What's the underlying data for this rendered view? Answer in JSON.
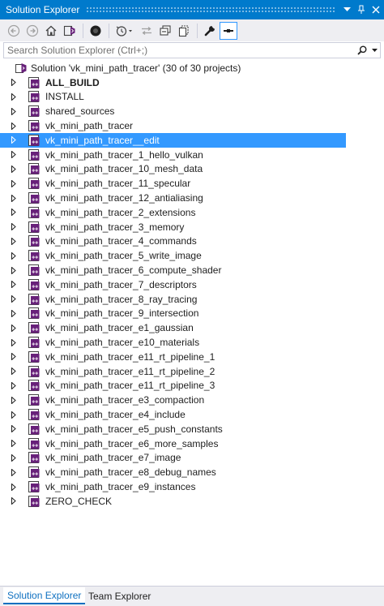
{
  "window": {
    "title": "Solution Explorer",
    "accent_color": "#007acc",
    "selection_color": "#3399ff"
  },
  "titlebar_buttons": [
    {
      "name": "window-position-dropdown",
      "icon": "chevron-down-icon"
    },
    {
      "name": "pin-button",
      "icon": "pin-icon"
    },
    {
      "name": "close-button",
      "icon": "close-icon"
    }
  ],
  "toolbar": [
    {
      "name": "back-button",
      "icon": "back-arrow-icon"
    },
    {
      "name": "forward-button",
      "icon": "forward-arrow-icon"
    },
    {
      "name": "home-button",
      "icon": "home-icon"
    },
    {
      "name": "switch-views-button",
      "icon": "visual-studio-icon"
    },
    {
      "name": "pending-changes-filter-button",
      "icon": "filter-circle-icon"
    },
    {
      "name": "history-button",
      "icon": "history-icon"
    },
    {
      "name": "sync-button",
      "icon": "sync-arrows-icon"
    },
    {
      "name": "collapse-all-button",
      "icon": "collapse-all-icon"
    },
    {
      "name": "show-all-files-button",
      "icon": "show-all-files-icon"
    },
    {
      "name": "properties-button",
      "icon": "wrench-icon"
    },
    {
      "name": "preview-selected-button",
      "icon": "preview-icon",
      "active": true
    }
  ],
  "search": {
    "placeholder": "Search Solution Explorer (Ctrl+;)",
    "value": ""
  },
  "solution": {
    "label": "Solution 'vk_mini_path_tracer' (30 of 30 projects)"
  },
  "projects": [
    {
      "label": "ALL_BUILD",
      "bold": true
    },
    {
      "label": "INSTALL"
    },
    {
      "label": "shared_sources"
    },
    {
      "label": "vk_mini_path_tracer"
    },
    {
      "label": "vk_mini_path_tracer__edit",
      "selected": true
    },
    {
      "label": "vk_mini_path_tracer_1_hello_vulkan"
    },
    {
      "label": "vk_mini_path_tracer_10_mesh_data"
    },
    {
      "label": "vk_mini_path_tracer_11_specular"
    },
    {
      "label": "vk_mini_path_tracer_12_antialiasing"
    },
    {
      "label": "vk_mini_path_tracer_2_extensions"
    },
    {
      "label": "vk_mini_path_tracer_3_memory"
    },
    {
      "label": "vk_mini_path_tracer_4_commands"
    },
    {
      "label": "vk_mini_path_tracer_5_write_image"
    },
    {
      "label": "vk_mini_path_tracer_6_compute_shader"
    },
    {
      "label": "vk_mini_path_tracer_7_descriptors"
    },
    {
      "label": "vk_mini_path_tracer_8_ray_tracing"
    },
    {
      "label": "vk_mini_path_tracer_9_intersection"
    },
    {
      "label": "vk_mini_path_tracer_e1_gaussian"
    },
    {
      "label": "vk_mini_path_tracer_e10_materials"
    },
    {
      "label": "vk_mini_path_tracer_e11_rt_pipeline_1"
    },
    {
      "label": "vk_mini_path_tracer_e11_rt_pipeline_2"
    },
    {
      "label": "vk_mini_path_tracer_e11_rt_pipeline_3"
    },
    {
      "label": "vk_mini_path_tracer_e3_compaction"
    },
    {
      "label": "vk_mini_path_tracer_e4_include"
    },
    {
      "label": "vk_mini_path_tracer_e5_push_constants"
    },
    {
      "label": "vk_mini_path_tracer_e6_more_samples"
    },
    {
      "label": "vk_mini_path_tracer_e7_image"
    },
    {
      "label": "vk_mini_path_tracer_e8_debug_names"
    },
    {
      "label": "vk_mini_path_tracer_e9_instances"
    },
    {
      "label": "ZERO_CHECK"
    }
  ],
  "bottom_tabs": [
    {
      "label": "Solution Explorer",
      "active": true
    },
    {
      "label": "Team Explorer"
    }
  ]
}
